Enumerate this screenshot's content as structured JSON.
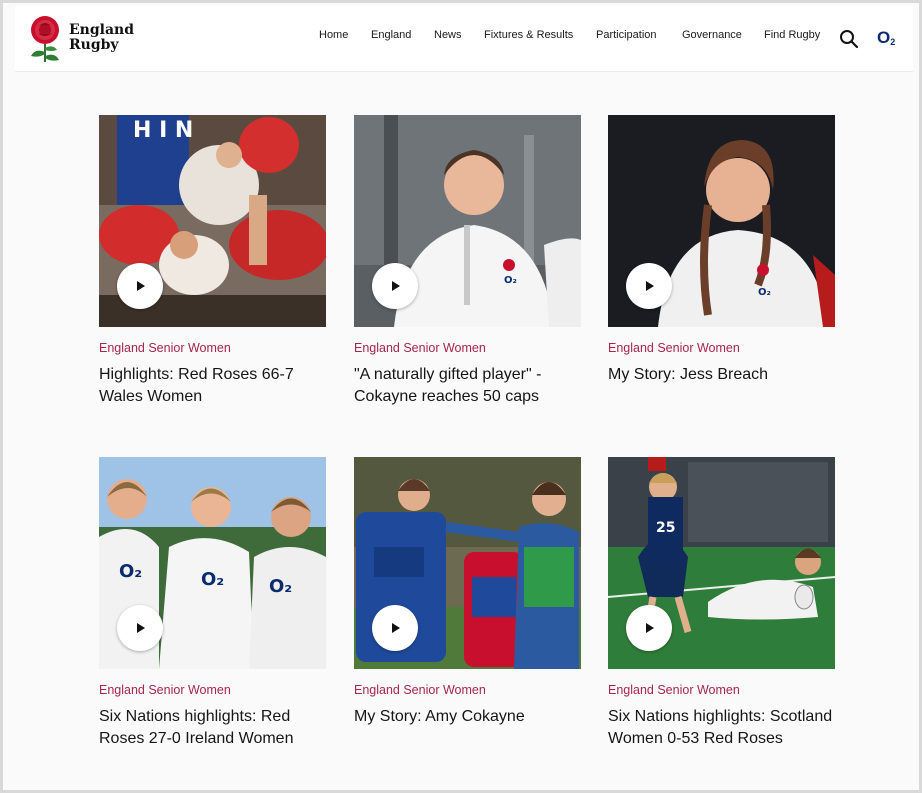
{
  "brand": {
    "name_line1": "England",
    "name_line2": "Rugby"
  },
  "nav": {
    "items": [
      {
        "label": "Home"
      },
      {
        "label": "England"
      },
      {
        "label": "News"
      },
      {
        "label": "Fixtures & Results"
      },
      {
        "label": "Participation"
      },
      {
        "label": "Governance"
      },
      {
        "label": "Find Rugby"
      }
    ],
    "search_icon": "search-icon",
    "sponsor_text": "O",
    "sponsor_sub": "2"
  },
  "videos": [
    {
      "category": "England Senior Women",
      "title": "Highlights: Red Roses 66-7 Wales Women"
    },
    {
      "category": "England Senior Women",
      "title": "\"A naturally gifted player\" - Cokayne reaches 50 caps"
    },
    {
      "category": "England Senior Women",
      "title": "My Story: Jess Breach"
    },
    {
      "category": "England Senior Women",
      "title": "Six Nations highlights: Red Roses 27-0 Ireland Women"
    },
    {
      "category": "England Senior Women",
      "title": "My Story: Amy Cokayne"
    },
    {
      "category": "England Senior Women",
      "title": "Six Nations highlights: Scotland Women 0-53 Red Roses"
    }
  ],
  "colors": {
    "category_accent": "#a8264a",
    "sponsor_blue": "#0a2c6e"
  }
}
